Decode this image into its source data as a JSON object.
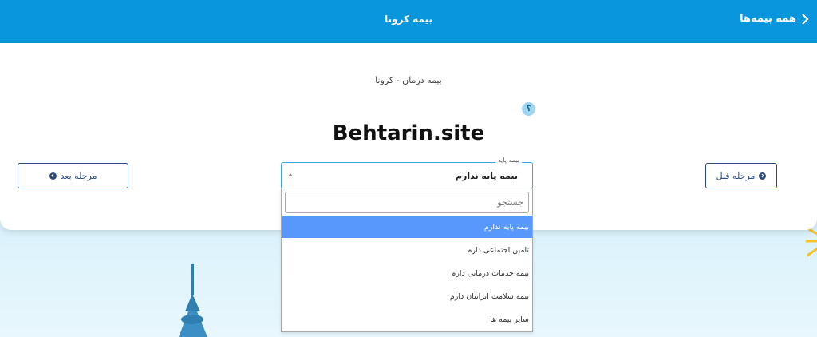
{
  "header": {
    "title": "بیمه کرونا",
    "back_label": "همه بیمه‌ها"
  },
  "main": {
    "subtitle": "بیمه درمان - کرونا",
    "watermark": "Behtarin.site",
    "prev_button": "مرحله قبل",
    "next_button": "مرحله بعد"
  },
  "select": {
    "legend": "بیمه پایه",
    "value": "بیمه پایه ندارم",
    "help": "؟",
    "search_placeholder": "جستجو",
    "options": [
      "بیمه پایه ندارم",
      "تامین اجتماعی دارم",
      "بیمه خدمات درمانی دارم",
      "بیمه سلامت ایرانیان دارم",
      "سایر بیمه ها"
    ],
    "highlighted_index": 0
  },
  "colors": {
    "header_bg": "#0a96dc",
    "accent": "#2c4a7a",
    "highlight": "#5897fb"
  }
}
